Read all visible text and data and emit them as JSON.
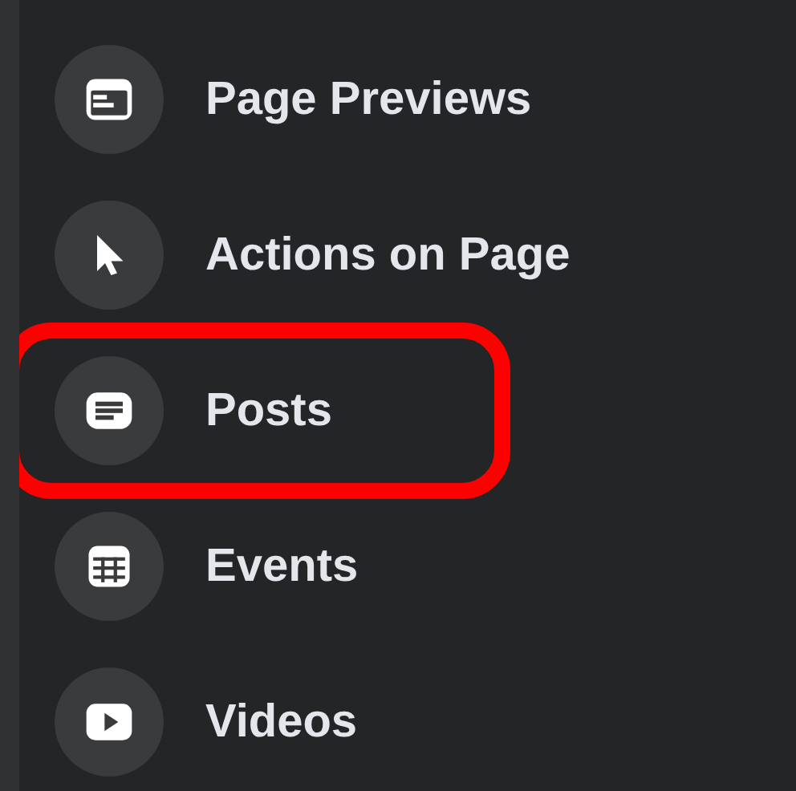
{
  "menu": {
    "items": [
      {
        "label": "Page Previews",
        "selected": false
      },
      {
        "label": "Actions on Page",
        "selected": false
      },
      {
        "label": "Posts",
        "selected": true
      },
      {
        "label": "Events",
        "selected": false
      },
      {
        "label": "Videos",
        "selected": false
      }
    ]
  }
}
